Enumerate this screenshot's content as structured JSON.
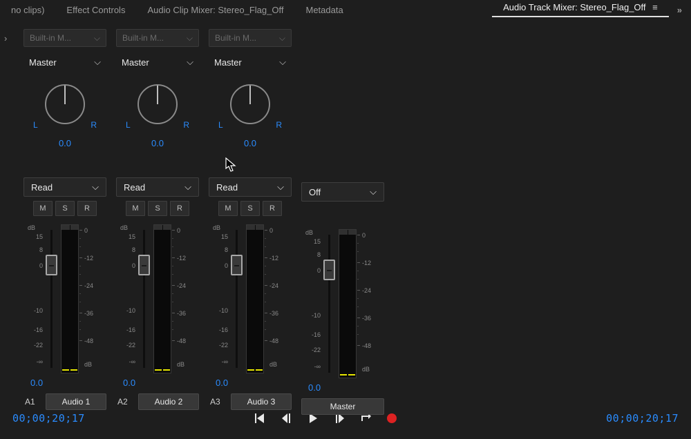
{
  "tabs": {
    "clips": "no clips)",
    "effect_controls": "Effect Controls",
    "clip_mixer": "Audio Clip Mixer: Stereo_Flag_Off",
    "metadata": "Metadata",
    "track_mixer": "Audio Track Mixer: Stereo_Flag_Off",
    "menu_glyph": "≡",
    "overflow": "»"
  },
  "disclosure_glyph": "›",
  "pan": {
    "L": "L",
    "R": "R"
  },
  "fader_scale_left": [
    "dB",
    "15",
    "8",
    "0",
    "-10",
    "-16",
    "-22",
    "-∞"
  ],
  "fader_scale_right": [
    "0",
    "-12",
    "-24",
    "-36",
    "-48",
    "dB"
  ],
  "msr_labels": {
    "mute": "M",
    "solo": "S",
    "record": "R"
  },
  "channels": [
    {
      "builtin": "Built-in M...",
      "output": "Master",
      "pan_value": "0.0",
      "automation": "Read",
      "volume": "0.0",
      "id": "A1",
      "name": "Audio 1"
    },
    {
      "builtin": "Built-in M...",
      "output": "Master",
      "pan_value": "0.0",
      "automation": "Read",
      "volume": "0.0",
      "id": "A2",
      "name": "Audio 2"
    },
    {
      "builtin": "Built-in M...",
      "output": "Master",
      "pan_value": "0.0",
      "automation": "Read",
      "volume": "0.0",
      "id": "A3",
      "name": "Audio 3"
    }
  ],
  "master": {
    "automation": "Off",
    "volume": "0.0",
    "name": "Master"
  },
  "transport": {
    "tc_left": "00;00;20;17",
    "tc_right": "00;00;20;17"
  }
}
